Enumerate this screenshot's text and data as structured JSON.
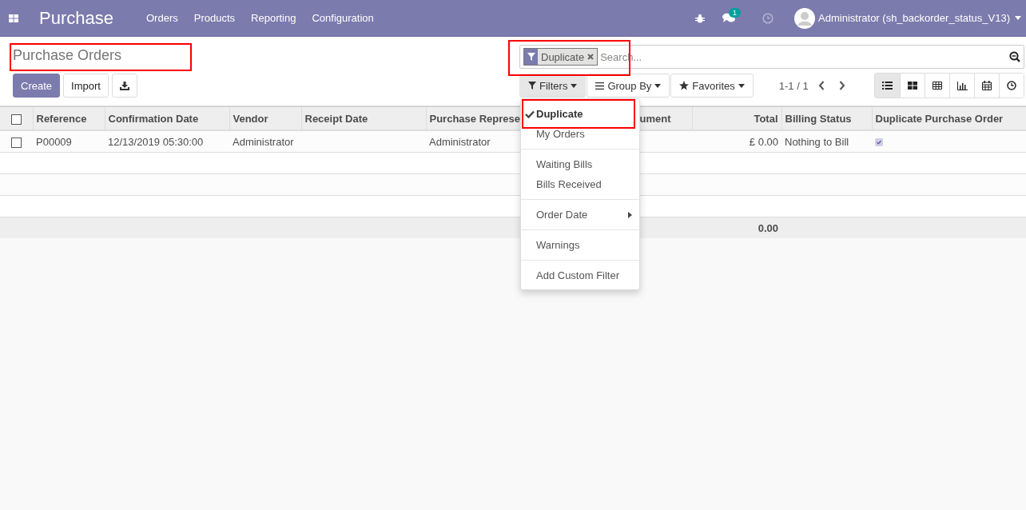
{
  "navbar": {
    "app_name": "Purchase",
    "menus": [
      "Orders",
      "Products",
      "Reporting",
      "Configuration"
    ],
    "chat_badge": "1",
    "user": "Administrator (sh_backorder_status_V13)"
  },
  "breadcrumb": {
    "title": "Purchase Orders",
    "highlighted": true
  },
  "buttons": [
    {
      "kind": "primary",
      "label": "Create"
    },
    {
      "kind": "secondary",
      "label": "Import"
    },
    {
      "kind": "download"
    }
  ],
  "search": {
    "facets": [
      {
        "label": "Duplicate"
      }
    ],
    "placeholder": "Search...",
    "highlighted": true
  },
  "search_menus": [
    {
      "kind": "filter",
      "label": "Filters",
      "selected": true
    },
    {
      "kind": "group",
      "label": "Group By",
      "selected": false
    },
    {
      "kind": "star",
      "label": "Favorites",
      "selected": false
    }
  ],
  "pager": "1-1 / 1",
  "views": [
    {
      "kind": "list",
      "selected": true
    },
    {
      "kind": "kanban",
      "selected": false
    },
    {
      "kind": "pivot",
      "selected": false
    },
    {
      "kind": "graph",
      "selected": false
    },
    {
      "kind": "calendar",
      "selected": false
    },
    {
      "kind": "activity",
      "selected": false
    }
  ],
  "table": {
    "all_selected": false,
    "columns": [
      "Reference",
      "Confirmation Date",
      "Vendor",
      "Receipt Date",
      "Purchase Represe",
      "ument",
      "Total",
      "Billing Status",
      "Duplicate Purchase Order"
    ],
    "rows": [
      {
        "selected": false,
        "cells": [
          "P00009",
          "12/13/2019 05:30:00",
          "Administrator",
          null,
          "Administrator",
          null,
          "£ 0.00",
          "Nothing to Bill"
        ],
        "duplicate": true
      }
    ],
    "footer_total": "0.00"
  },
  "filters_menu": {
    "groups": [
      [
        {
          "label": "Duplicate",
          "checked": true,
          "highlighted": true
        },
        {
          "label": "My Orders",
          "checked": false
        }
      ],
      [
        {
          "label": "Waiting Bills",
          "checked": false
        },
        {
          "label": "Bills Received",
          "checked": false
        }
      ],
      [
        {
          "label": "Order Date",
          "checked": false,
          "submenu": true
        }
      ],
      [
        {
          "label": "Warnings",
          "checked": false
        }
      ],
      [
        {
          "label": "Add Custom Filter",
          "checked": false
        }
      ]
    ]
  }
}
